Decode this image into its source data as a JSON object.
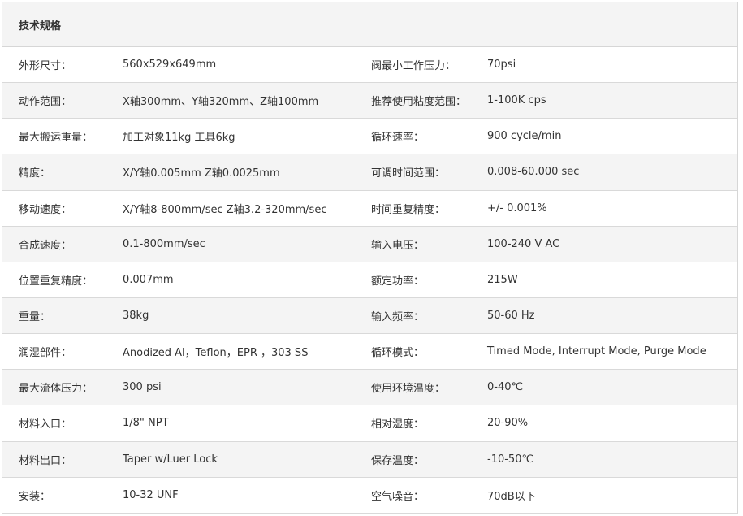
{
  "title": "技术规格",
  "rows": [
    {
      "label_left": "外形尺寸：",
      "value_left": "560x529x649mm",
      "label_right": "阀最小工作压力：",
      "value_right": "70psi"
    },
    {
      "label_left": "动作范围：",
      "value_left": "X轴300mm、Y轴320mm、Z轴100mm",
      "label_right": "推荐使用粘度范围：",
      "value_right": "1-100K cps"
    },
    {
      "label_left": "最大搬运重量：",
      "value_left": "加工对象11kg  工具6kg",
      "label_right": "循环速率：",
      "value_right": "900 cycle/min"
    },
    {
      "label_left": "精度：",
      "value_left": "X/Y轴0.005mm  Z轴0.0025mm",
      "label_right": "可调时间范围：",
      "value_right": "0.008-60.000 sec"
    },
    {
      "label_left": "移动速度：",
      "value_left": "X/Y轴8-800mm/sec    Z轴3.2-320mm/sec",
      "label_right": "时间重复精度：",
      "value_right": "+/- 0.001%"
    },
    {
      "label_left": "合成速度：",
      "value_left": "0.1-800mm/sec",
      "label_right": "输入电压：",
      "value_right": "100-240 V AC"
    },
    {
      "label_left": "位置重复精度：",
      "value_left": "0.007mm",
      "label_right": "额定功率：",
      "value_right": "215W"
    },
    {
      "label_left": "重量：",
      "value_left": "38kg",
      "label_right": "输入频率：",
      "value_right": "50-60 Hz"
    },
    {
      "label_left": "润湿部件：",
      "value_left": "Anodized Al，Teflon，EPR ，303 SS",
      "label_right": "循环模式：",
      "value_right": "Timed Mode, Interrupt Mode, Purge Mode"
    },
    {
      "label_left": "最大流体压力：",
      "value_left": "300 psi",
      "label_right": "使用环境温度：",
      "value_right": "0-40℃"
    },
    {
      "label_left": "材料入口：",
      "value_left": "1/8\" NPT",
      "label_right": "相对湿度：",
      "value_right": "20-90%"
    },
    {
      "label_left": "材料出口：",
      "value_left": "Taper w/Luer Lock",
      "label_right": "保存温度：",
      "value_right": "-10-50℃"
    },
    {
      "label_left": "安装：",
      "value_left": "10-32 UNF",
      "label_right": "空气噪音：",
      "value_right": "70dB以下"
    }
  ]
}
